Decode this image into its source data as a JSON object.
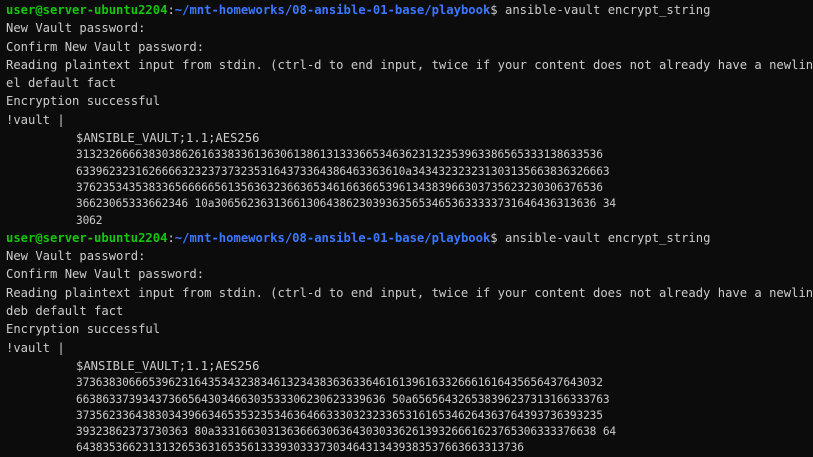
{
  "blocks": [
    {
      "prompt": {
        "userhost": "user@server-ubuntu2204",
        "sep": ":",
        "path": "~/mnt-homeworks/08-ansible-01-base/playbook",
        "symbol": "$",
        "command": " ansible-vault encrypt_string"
      },
      "output": [
        "New Vault password:",
        "Confirm New Vault password:",
        "Reading plaintext input from stdin. (ctrl-d to end input, twice if your content does not already have a newline)",
        "el default fact",
        "Encryption successful",
        "!vault |"
      ],
      "vault_header": "$ANSIBLE_VAULT;1.1;AES256",
      "vault_lines": [
        "31323266663830386261633833613630613861313336653463623132353963386565333138633536",
        "63396232316266663232373732353164373364386463363610a343432323231303135663836326663",
        "37623534353833656666656135636323663653461663665396134383966303735623230306376536",
        "36623065333662346 10a3065623631366130643862303936356534653633333731646436313636 34",
        "3062"
      ]
    },
    {
      "prompt": {
        "userhost": "user@server-ubuntu2204",
        "sep": ":",
        "path": "~/mnt-homeworks/08-ansible-01-base/playbook",
        "symbol": "$",
        "command": " ansible-vault encrypt_string"
      },
      "output": [
        "New Vault password:",
        "Confirm New Vault password:",
        "Reading plaintext input from stdin. (ctrl-d to end input, twice if your content does not already have a newline)",
        "deb default fact",
        "Encryption successful",
        "!vault |"
      ],
      "vault_header": "$ANSIBLE_VAULT;1.1;AES256",
      "vault_lines": [
        "37363830666539623164353432383461323438363633646161396163326661616435656437643032",
        "66386337393437366564303466303533306230623339636 50a656564326538396237313166333763",
        "37356233643830343966346535323534636466333032323365316165346264363764393736393235",
        "39323862373730363 80a3331663031363666306364303033626139326661623765306333376638 64",
        "64383536623131326536316535613339303337303464313439383537663663313736"
      ]
    }
  ]
}
